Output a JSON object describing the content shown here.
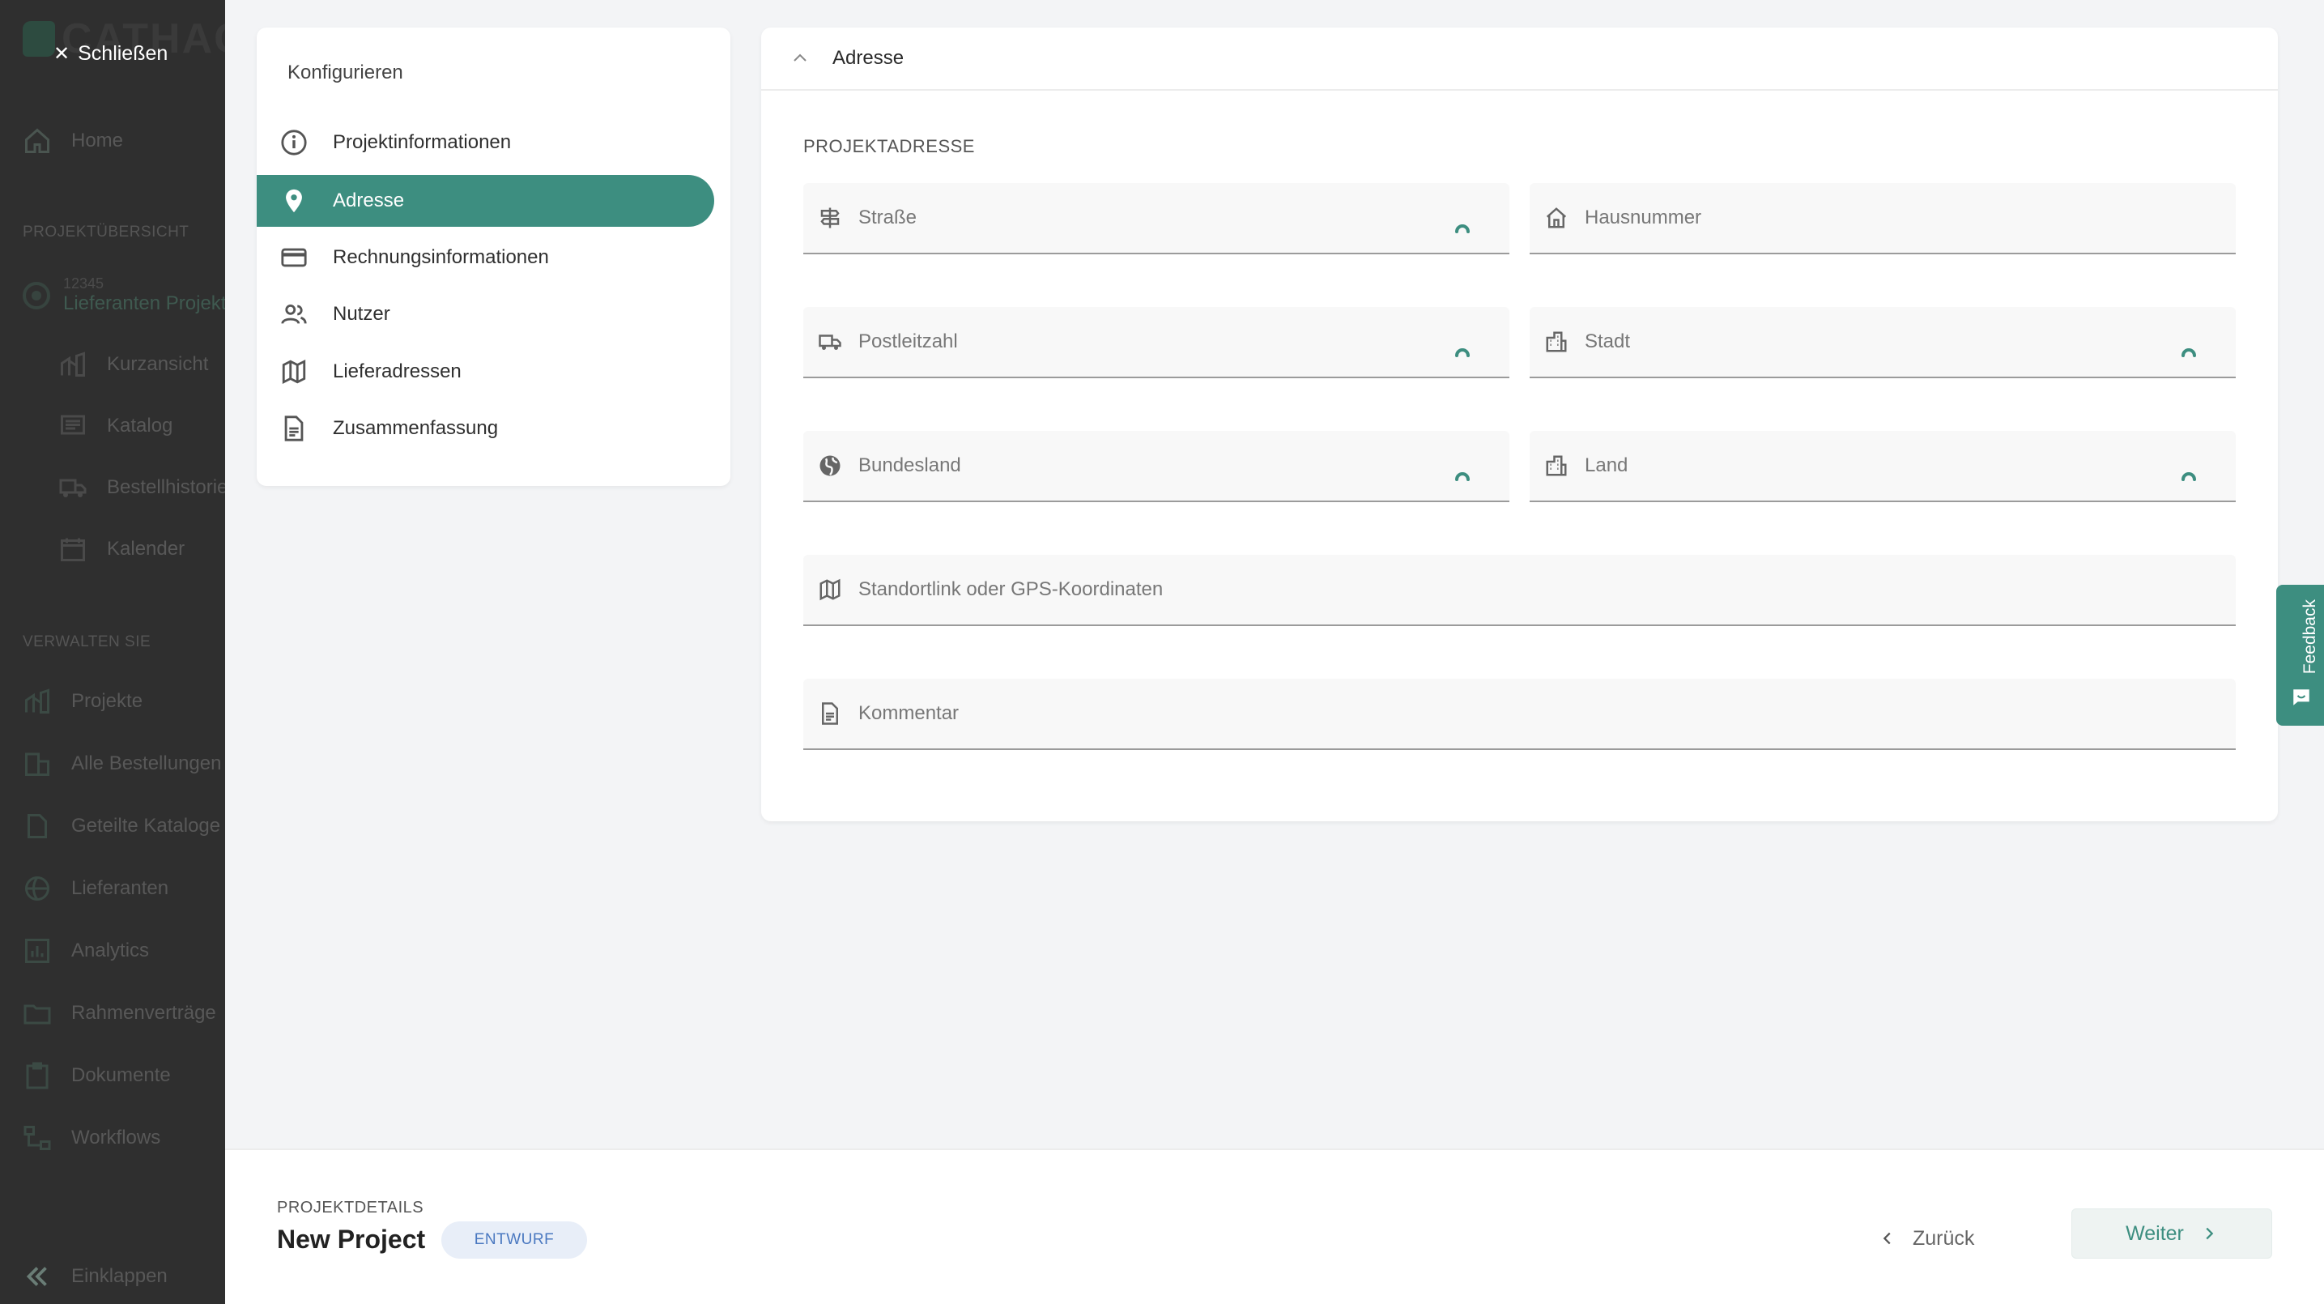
{
  "sidebar": {
    "logo_text": "CATHAG",
    "close_label": "Schließen",
    "home_label": "Home",
    "section_projects": "PROJEKTÜBERSICHT",
    "project_number": "12345",
    "project_name": "Lieferanten Projekt",
    "project_items": [
      {
        "label": "Kurzansicht",
        "icon": "chart-icon"
      },
      {
        "label": "Katalog",
        "icon": "list-icon"
      },
      {
        "label": "Bestellhistorie",
        "icon": "truck-icon"
      },
      {
        "label": "Kalender",
        "icon": "calendar-icon"
      }
    ],
    "section_manage": "VERWALTEN SIE",
    "manage_items": [
      {
        "label": "Projekte",
        "icon": "chart-icon"
      },
      {
        "label": "Alle Bestellungen",
        "icon": "buildings-icon"
      },
      {
        "label": "Geteilte Kataloge",
        "icon": "document-icon"
      },
      {
        "label": "Lieferanten",
        "icon": "globe-icon"
      },
      {
        "label": "Analytics",
        "icon": "analytics-icon"
      },
      {
        "label": "Rahmenverträge",
        "icon": "folder-icon"
      },
      {
        "label": "Dokumente",
        "icon": "clipboard-icon"
      },
      {
        "label": "Workflows",
        "icon": "workflow-icon"
      }
    ],
    "collapse_label": "Einklappen"
  },
  "config": {
    "title": "Konfigurieren",
    "steps": [
      {
        "label": "Projektinformationen",
        "icon": "info-icon",
        "active": false
      },
      {
        "label": "Adresse",
        "icon": "location-pin-icon",
        "active": true
      },
      {
        "label": "Rechnungsinformationen",
        "icon": "credit-card-icon",
        "active": false
      },
      {
        "label": "Nutzer",
        "icon": "users-icon",
        "active": false
      },
      {
        "label": "Lieferadressen",
        "icon": "map-icon",
        "active": false
      },
      {
        "label": "Zusammenfassung",
        "icon": "document-icon",
        "active": false
      }
    ]
  },
  "address": {
    "header": "Adresse",
    "section_title": "PROJEKTADRESSE",
    "fields": {
      "street": "Straße",
      "house_number": "Hausnummer",
      "postal_code": "Postleitzahl",
      "city": "Stadt",
      "state": "Bundesland",
      "country": "Land",
      "location_link": "Standortlink oder GPS-Koordinaten",
      "comment": "Kommentar"
    }
  },
  "feedback_label": "Feedback",
  "footer": {
    "kicker": "PROJEKTDETAILS",
    "project_name": "New Project",
    "status_badge": "ENTWURF",
    "back_label": "Zurück",
    "next_label": "Weiter"
  },
  "colors": {
    "accent": "#3d8e80",
    "sidebar_bg": "#2f2f2f",
    "page_bg": "#f3f4f6",
    "badge_bg": "#e8eef8",
    "badge_text": "#4a78c0"
  }
}
